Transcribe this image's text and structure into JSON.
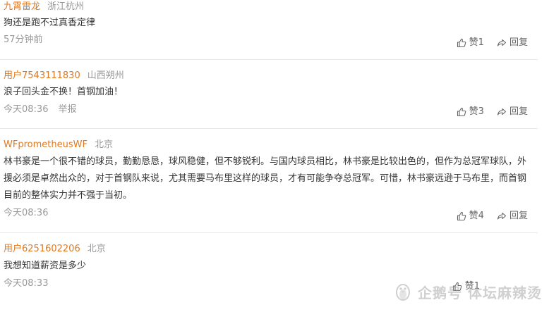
{
  "comments": [
    {
      "user": "九霄雷龙",
      "location": "浙江杭州",
      "text": "狗还是跑不过真香定律",
      "time": "57分钟前",
      "report": "",
      "likes": "赞1",
      "reply": "回复"
    },
    {
      "user": "用户7543111830",
      "location": "山西朔州",
      "text": "浪子回头金不换！首钢加油！",
      "time": "今天08:36",
      "report": "举报",
      "likes": "赞3",
      "reply": "回复"
    },
    {
      "user": "WFprometheusWF",
      "location": "北京",
      "text": "林书豪是一个很不错的球员，勤勤恳恳，球风稳健，但不够锐利。与国内球员相比，林书豪是比较出色的，但作为总冠军球队，外援必须是卓然出众的，对于首钢队来说，尤其需要马布里这样的球员，才有可能争夺总冠军。可惜，林书豪远逊于马布里，而首钢目前的整体实力并不强于当初。",
      "time": "今天08:36",
      "report": "",
      "likes": "赞4",
      "reply": "回复"
    },
    {
      "user": "用户6251602206",
      "location": "北京",
      "text": "我想知道薪资是多少",
      "time": "今天08:33",
      "report": "",
      "likes": "赞1",
      "reply": ""
    }
  ],
  "watermark": {
    "text": "企鹅号 体坛麻辣烫",
    "icon": "penguin-logo-icon"
  },
  "colors": {
    "username": "#e0781e",
    "meta": "#999999",
    "text": "#333333",
    "divider": "#e8e8e8"
  }
}
